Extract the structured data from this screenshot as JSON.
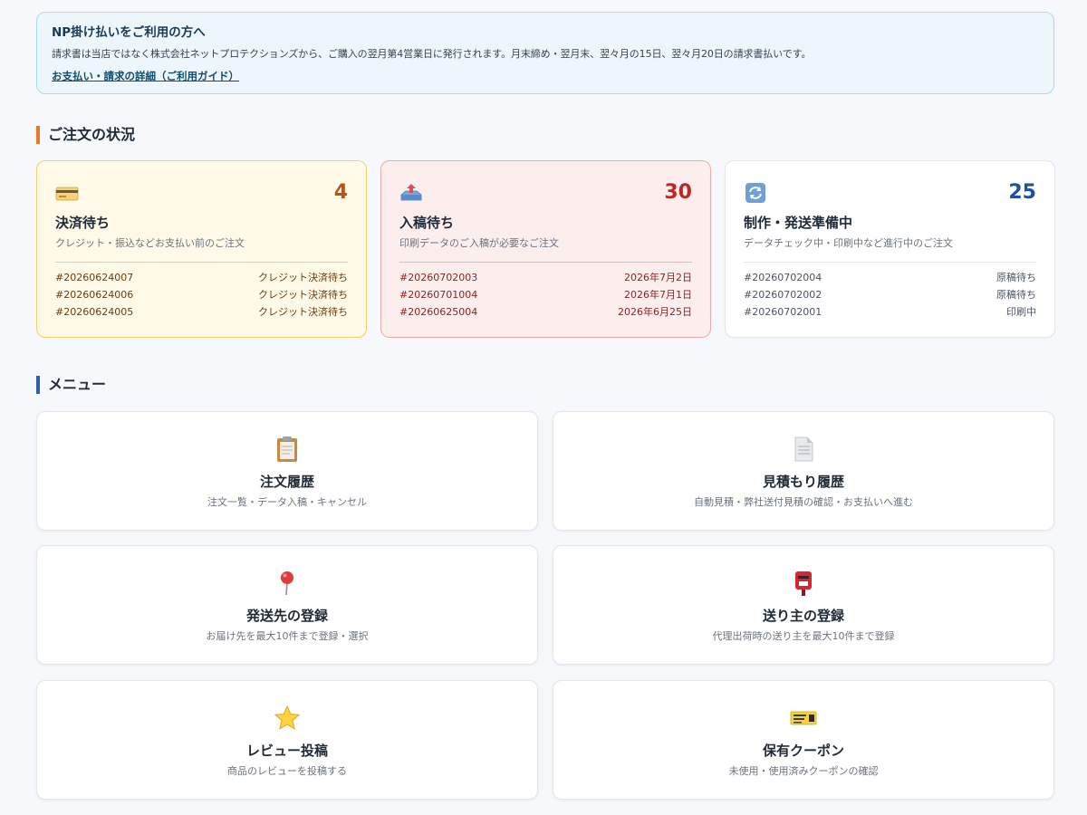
{
  "notice": {
    "title": "NP掛け払いをご利用の方へ",
    "body": "請求書は当店ではなく株式会社ネットプロテクションズから、ご購入の翌月第4営業日に発行されます。月末締め・翌月末、翌々月の15日、翌々月20日の請求書払いです。",
    "link": "お支払い・請求の詳細（ご利用ガイド）"
  },
  "order_status": {
    "heading": "ご注文の状況",
    "cards": [
      {
        "icon": "credit-card-icon",
        "count": "4",
        "title": "決済待ち",
        "subtitle": "クレジット・振込などお支払い前のご注文",
        "rows": [
          {
            "id": "#20260624007",
            "value": "クレジット決済待ち"
          },
          {
            "id": "#20260624006",
            "value": "クレジット決済待ち"
          },
          {
            "id": "#20260624005",
            "value": "クレジット決済待ち"
          }
        ]
      },
      {
        "icon": "inbox-tray-icon",
        "count": "30",
        "title": "入稿待ち",
        "subtitle": "印刷データのご入稿が必要なご注文",
        "rows": [
          {
            "id": "#20260702003",
            "value": "2026年7月2日"
          },
          {
            "id": "#20260701004",
            "value": "2026年7月1日"
          },
          {
            "id": "#20260625004",
            "value": "2026年6月25日"
          }
        ]
      },
      {
        "icon": "refresh-icon",
        "count": "25",
        "title": "制作・発送準備中",
        "subtitle": "データチェック中・印刷中など進行中のご注文",
        "rows": [
          {
            "id": "#20260702004",
            "value": "原稿待ち"
          },
          {
            "id": "#20260702002",
            "value": "原稿待ち"
          },
          {
            "id": "#20260702001",
            "value": "印刷中"
          }
        ]
      }
    ]
  },
  "menu": {
    "heading": "メニュー",
    "items": [
      {
        "icon": "clipboard-icon",
        "title": "注文履歴",
        "subtitle": "注文一覧・データ入稿・キャンセル"
      },
      {
        "icon": "document-icon",
        "title": "見積もり履歴",
        "subtitle": "自動見積・弊社送付見積の確認・お支払いへ進む"
      },
      {
        "icon": "pushpin-icon",
        "title": "発送先の登録",
        "subtitle": "お届け先を最大10件まで登録・選択"
      },
      {
        "icon": "postbox-icon",
        "title": "送り主の登録",
        "subtitle": "代理出荷時の送り主を最大10件まで登録"
      },
      {
        "icon": "star-icon",
        "title": "レビュー投稿",
        "subtitle": "商品のレビューを投稿する"
      },
      {
        "icon": "ticket-icon",
        "title": "保有クーポン",
        "subtitle": "未使用・使用済みクーポンの確認"
      }
    ]
  }
}
